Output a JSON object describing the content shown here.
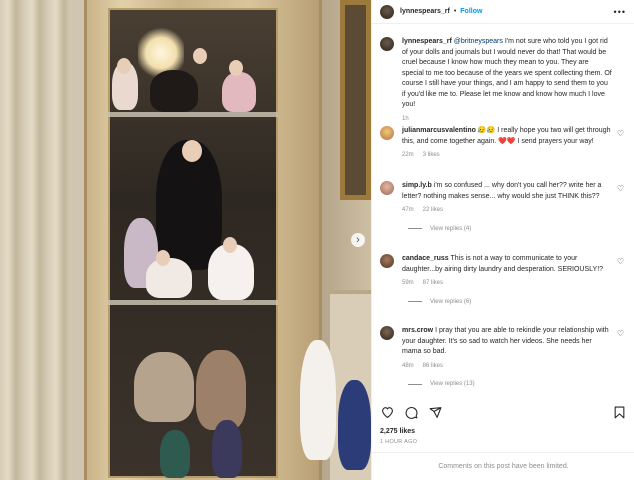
{
  "post": {
    "username": "lynnespears_rf",
    "follow_label": "Follow",
    "more_label": "•••",
    "caption": {
      "username": "lynnespears_rf",
      "mention": "@britneyspears",
      "text": "I'm not sure who told you I got rid of your dolls and journals but I would never do that! That would be cruel because I know how much they mean to you. They are special to me too because of the years we spent collecting them. Of course I still have your things, and I am happy to send them to you if you'd like me to. Please let me know and know how much I love you!",
      "time": "1h"
    },
    "comments": [
      {
        "username": "julianmarcusvalentino",
        "text": "😥😥 I really hope you two will get through this, and come together again. ❤️❤️ I send prayers your way!",
        "time": "22m",
        "likes": "3 likes",
        "replies": ""
      },
      {
        "username": "simp.ly.b",
        "text": "i'm so confused ... why don't you call her?? write her a letter? nothing makes sense... why would she just THINK this??",
        "time": "47m",
        "likes": "22 likes",
        "replies": "View replies (4)"
      },
      {
        "username": "candace_russ",
        "text": "This is not a way to communicate to your daughter...by airing dirty laundry and desperation. SERIOUSLY!?",
        "time": "59m",
        "likes": "87 likes",
        "replies": "View replies (6)"
      },
      {
        "username": "mrs.crow",
        "text": "I pray that you are able to rekindle your relationship with your daughter. It's so sad to watch her videos. She needs her mama so bad.",
        "time": "48m",
        "likes": "86 likes",
        "replies": "View replies (13)"
      }
    ],
    "likes_count": "2,275",
    "likes_suffix": "likes",
    "date": "1 HOUR AGO",
    "comments_limited": "Comments on this post have been limited."
  },
  "icons": {
    "heart": "heart-icon",
    "comment": "comment-icon",
    "share": "share-icon",
    "save": "bookmark-icon",
    "next": "chevron-right-icon"
  },
  "colors": {
    "link": "#0095f6",
    "muted": "#8e8e8e",
    "text": "#262626"
  }
}
